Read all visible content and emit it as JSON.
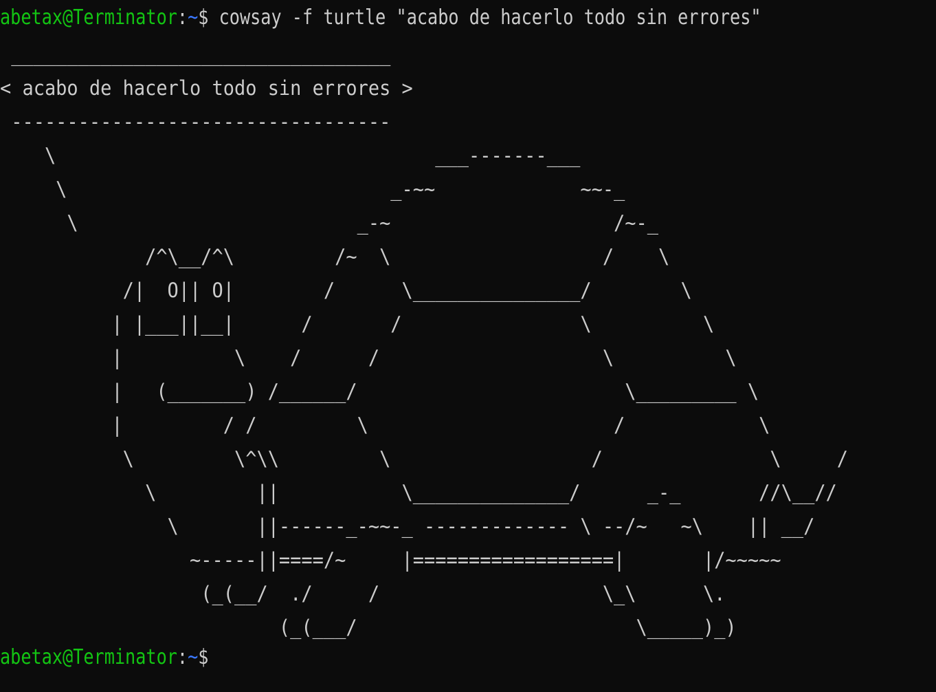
{
  "terminal": {
    "colors": {
      "background": "#0c0c0c",
      "foreground": "#cccccc",
      "user_host": "#13c513",
      "path": "#3b78ff"
    },
    "prompt": {
      "user_host": "abetax@Terminator",
      "colon": ":",
      "path": "~",
      "symbol": "$"
    },
    "command": " cowsay -f turtle \"acabo de hacerlo todo sin errores\"",
    "output": " __________________________________\n< acabo de hacerlo todo sin errores >\n ----------------------------------\n    \\                                  ___-------___\n     \\                             _-~~             ~~-_\n      \\                         _-~                    /~-_\n             /^\\__/^\\         /~  \\                   /    \\\n           /|  O|| O|        /      \\_______________/        \\\n          | |___||__|      /       /                \\          \\\n          |          \\    /      /                    \\          \\\n          |   (_______) /______/                        \\_________ \\\n          |         / /         \\                      /            \\\n           \\         \\^\\\\         \\                  /               \\     /\n             \\         ||           \\______________/      _-_       //\\__//\n               \\       ||------_-~~-_ ------------- \\ --/~   ~\\    || __/\n                 ~-----||====/~     |==================|       |/~~~~~\n                  (_(__/  ./     /                    \\_\\      \\.\n                         (_(___/                         \\_____)_)"
  }
}
